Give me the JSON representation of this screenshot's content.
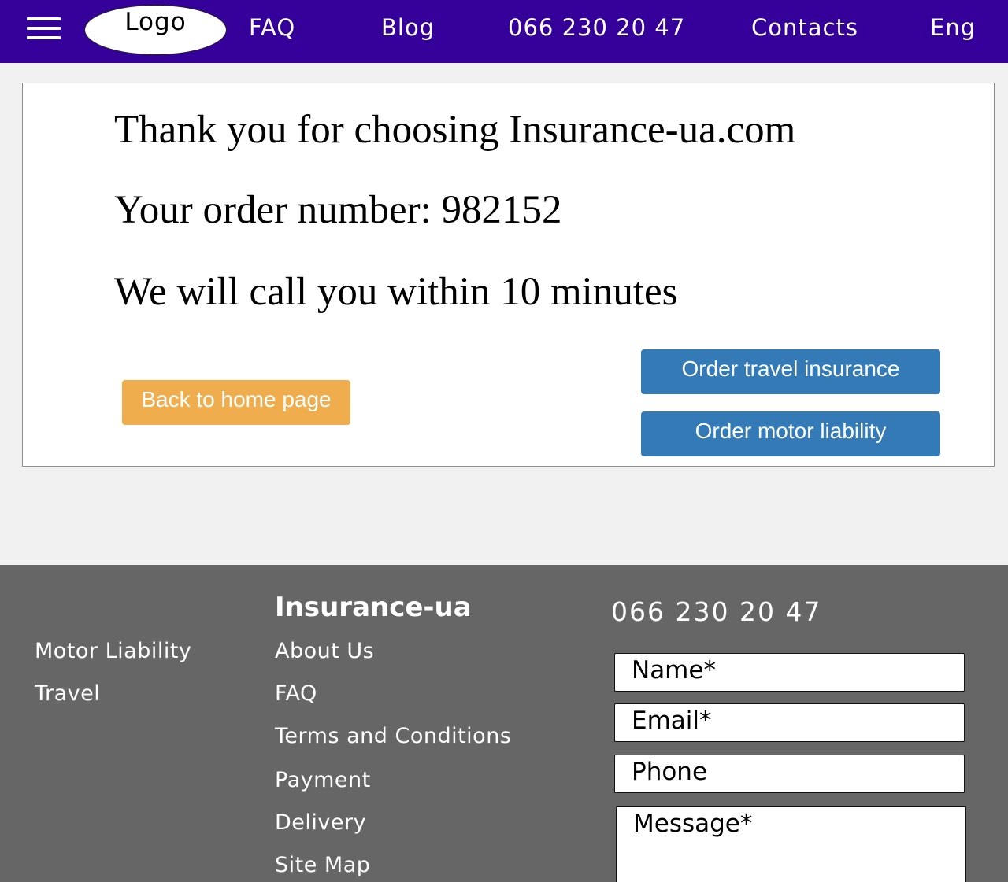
{
  "header": {
    "menu_icon": "hamburger-menu-icon",
    "logo": "Logo",
    "nav": {
      "faq": "FAQ",
      "blog": "Blog",
      "phone": "066 230 20 47",
      "contacts": "Contacts",
      "language": "Eng"
    }
  },
  "confirmation": {
    "thanks": "Thank you for choosing Insurance-ua.com",
    "order": "Your order number: 982152",
    "callback": "We will call you within 10 minutes"
  },
  "buttons": {
    "home": "Back to home page",
    "travel": "Order travel insurance",
    "motor": "Order motor liability"
  },
  "footer": {
    "products": [
      "Motor Liability",
      "Travel"
    ],
    "brand": "Insurance-ua",
    "links": [
      "About Us",
      "FAQ",
      "Terms and Conditions",
      "Payment",
      "Delivery",
      "Site Map"
    ],
    "phone": "066 230 20 47",
    "form": {
      "name": "Name*",
      "email": "Email*",
      "phone": "Phone",
      "message": "Message*"
    }
  },
  "colors": {
    "header_bg": "#35009a",
    "page_bg": "#f1f1f1",
    "footer_bg": "#666666",
    "orange_button": "#f0ad4e",
    "blue_button": "#337ab7"
  }
}
